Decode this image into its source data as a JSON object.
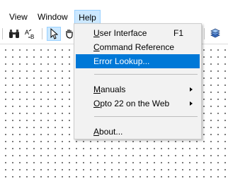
{
  "menubar": {
    "items": [
      {
        "label": "View"
      },
      {
        "label": "Window"
      },
      {
        "label": "Help"
      }
    ]
  },
  "toolbar": {
    "icons": [
      "binoculars-icon",
      "spell-check-icon",
      "pointer-icon",
      "pan-hand-icon",
      "library-icon"
    ]
  },
  "help_menu": {
    "items": [
      {
        "label_first": "U",
        "label_rest": "ser Interface",
        "shortcut": "F1"
      },
      {
        "label_first": "C",
        "label_rest": "ommand Reference"
      },
      {
        "label_first": "",
        "label_rest": "Error Lookup...",
        "highlighted": true
      },
      {
        "label_first": "M",
        "label_rest": "anuals"
      },
      {
        "label_first": "O",
        "label_rest": "pto 22 on the Web"
      },
      {
        "label_first": "A",
        "label_rest": "bout..."
      }
    ]
  },
  "colors": {
    "highlight": "#0078d7",
    "menu_active": "#cce8ff",
    "menu_bg": "#f2f2f2"
  }
}
